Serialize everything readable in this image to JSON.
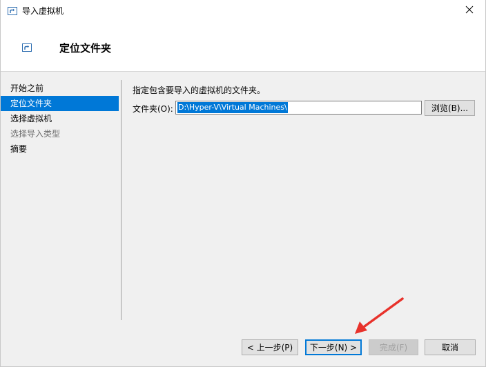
{
  "window": {
    "title": "导入虚拟机",
    "close_glyph": "✕"
  },
  "header": {
    "title": "定位文件夹"
  },
  "nav": {
    "items": [
      {
        "label": "开始之前",
        "state": "normal"
      },
      {
        "label": "定位文件夹",
        "state": "active"
      },
      {
        "label": "选择虚拟机",
        "state": "normal"
      },
      {
        "label": "选择导入类型",
        "state": "disabled"
      },
      {
        "label": "摘要",
        "state": "normal"
      }
    ]
  },
  "content": {
    "instruction": "指定包含要导入的虚拟机的文件夹。",
    "folder_label": "文件夹(O):",
    "folder_value": "D:\\Hyper-V\\Virtual Machines\\",
    "browse_label": "浏览(B)..."
  },
  "footer": {
    "prev_label": "< 上一步(P)",
    "next_label": "下一步(N) >",
    "finish_label": "完成(F)",
    "cancel_label": "取消"
  },
  "colors": {
    "accent": "#0078d7",
    "annotation_arrow": "#e8322b"
  }
}
